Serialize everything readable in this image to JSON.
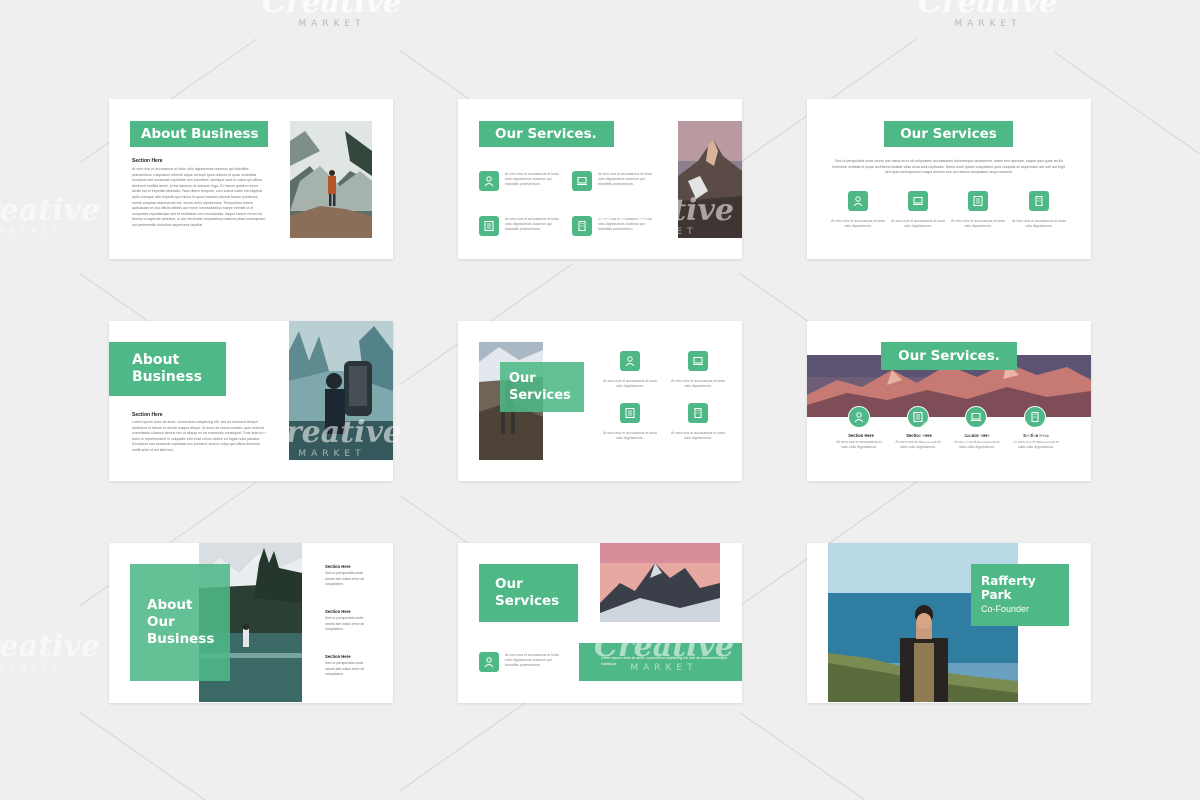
{
  "watermark": {
    "logo": "Creative",
    "sub": "MARKET"
  },
  "slides": {
    "s1": {
      "title": "About Business",
      "section_head": "Section Here",
      "paragraph": "At vero eos et accusamus et iusto odio dignissimos ducimus qui blanditiis praesentium voluptatum deleniti atque corrupti quos dolores et quas molestias excepturi sint occaecati cupiditate non provident, similique sunt in culpa qui officia deserunt mollitia animi, id est laborum et dolorum fuga. Et harum quidem rerum facilis est et expedita distinctio. Nam libero tempore, cum soluta nobis est eligendi optio cumque nihil impedit quo minus id quod maxime placeat facere possimus, omnis voluptas assumenda est, omnis dolor repellendus. Temporibus autem quibusdam et aut officiis debitis aut rerum necessitatibus saepe eveniet ut et voluptates repudiandae sint et molestiae non recusandae. Itaque earum rerum hic tenetur a sapiente delectus, ut aut reiciendis voluptatibus maiores alias consequatur aut perferendis doloribus asperiores repellat."
    },
    "s2": {
      "title": "Our Services.",
      "services": [
        {
          "icon": "user-icon",
          "text": "At vero eos et accusamus et iusto odio dignissimos ducimus qui blanditiis praesentium."
        },
        {
          "icon": "laptop-icon",
          "text": "At vero eos et accusamus et iusto odio dignissimos ducimus qui blanditiis praesentium."
        },
        {
          "icon": "checklist-icon",
          "text": "At vero eos et accusamus et iusto odio dignissimos ducimus qui blanditiis praesentium."
        },
        {
          "icon": "building-icon",
          "text": "At vero eos et accusamus et iusto odio dignissimos ducimus qui blanditiis praesentium."
        }
      ]
    },
    "s3": {
      "title": "Our Services",
      "paragraph": "Sed ut perspiciatis unde omnis iste natus error sit voluptatem accusantium doloremque laudantium, totam rem aperiam, eaque ipsa quae ab illo inventore veritatis et quasi architecto beatae vitae dicta sunt explicabo. Nemo enim ipsam voluptatem quia voluptas sit aspernatur aut odit aut fugit, sed quia consequuntur magni dolores eos qui ratione voluptatem sequi nesciunt.",
      "services": [
        {
          "icon": "user-icon",
          "text": "At vero eos et accusamus et iusto odio dignissimos."
        },
        {
          "icon": "laptop-icon",
          "text": "At vero eos et accusamus et iusto odio dignissimos."
        },
        {
          "icon": "checklist-icon",
          "text": "At vero eos et accusamus et iusto odio dignissimos."
        },
        {
          "icon": "building-icon",
          "text": "At vero eos et accusamus et iusto odio dignissimos."
        }
      ]
    },
    "s4": {
      "title_line1": "About",
      "title_line2": "Business",
      "section_head": "Section Here",
      "paragraph": "Lorem ipsum dolor sit amet, consectetur adipiscing elit, sed do eiusmod tempor incididunt ut labore et dolore magna aliqua. Ut enim ad minim veniam, quis nostrud exercitation ullamco laboris nisi ut aliquip ex ea commodo consequat. Duis aute irure dolor in reprehenderit in voluptate velit esse cillum dolore eu fugiat nulla pariatur. Excepteur sint occaecat cupidatat non proident, sunt in culpa qui officia deserunt mollit anim id est laborum."
    },
    "s5": {
      "title_line1": "Our",
      "title_line2": "Services",
      "services": [
        {
          "icon": "user-icon",
          "text": "At vero eos et accusamus et iusto odio dignissimos."
        },
        {
          "icon": "laptop-icon",
          "text": "At vero eos et accusamus et iusto odio dignissimos."
        },
        {
          "icon": "checklist-icon",
          "text": "At vero eos et accusamus et iusto odio dignissimos."
        },
        {
          "icon": "building-icon",
          "text": "At vero eos et accusamus et iusto odio dignissimos."
        }
      ]
    },
    "s6": {
      "title": "Our Services.",
      "services": [
        {
          "icon": "user-icon",
          "head": "Section Here",
          "text": "At vero eos et accusamus et iusto odio dignissimos."
        },
        {
          "icon": "checklist-icon",
          "head": "Section Here",
          "text": "At vero eos et accusamus et iusto odio dignissimos."
        },
        {
          "icon": "laptop-icon",
          "head": "Section Here",
          "text": "At vero eos et accusamus et iusto odio dignissimos."
        },
        {
          "icon": "building-icon",
          "head": "Section Here",
          "text": "At vero eos et accusamus et iusto odio dignissimos."
        }
      ]
    },
    "s7": {
      "title_line1": "About",
      "title_line2": "Our",
      "title_line3": "Business",
      "sections": [
        {
          "head": "Section Here",
          "text": "Sed ut perspiciatis unde omnis iste natus error sit voluptatem."
        },
        {
          "head": "Section Here",
          "text": "Sed ut perspiciatis unde omnis iste natus error sit voluptatem."
        },
        {
          "head": "Section Here",
          "text": "Sed ut perspiciatis unde omnis iste natus error sit voluptatem."
        }
      ]
    },
    "s8": {
      "title_line1": "Our",
      "title_line2": "Services",
      "service_text": "At vero eos et accusamus et iusto odio dignissimos ducimus qui blanditiis praesentium.",
      "band_text": "Lorem ipsum dolor sit amet, consectetur adipiscing elit, sed do eiusmod tempor incididunt."
    },
    "s9": {
      "name_line1": "Rafferty",
      "name_line2": "Park",
      "role": "Co-Founder"
    }
  }
}
